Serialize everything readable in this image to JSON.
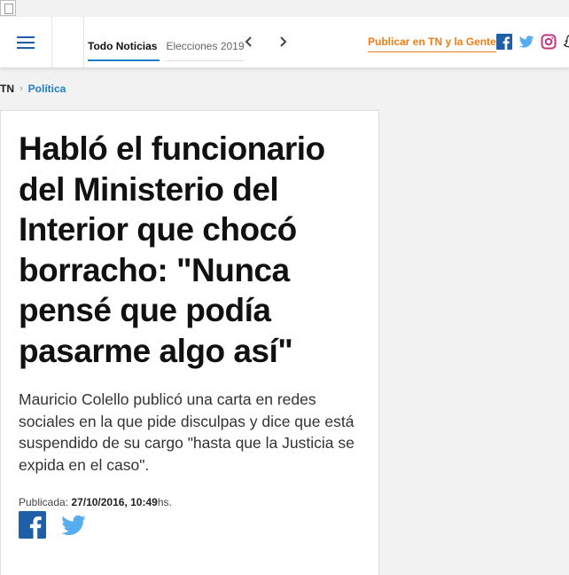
{
  "colors": {
    "brand_blue": "#1e5fa8",
    "tab_accent": "#1f7ec7",
    "publicar_orange": "#f07d16",
    "facebook": "#3b5998",
    "twitter": "#55acee",
    "instagram": "#c13584"
  },
  "header": {
    "menu_icon": "hamburger-icon",
    "tabs": [
      {
        "label": "Todo Noticias",
        "active": true
      },
      {
        "label": "Elecciones 2019",
        "active": false
      }
    ],
    "prev_icon": "chevron-left-icon",
    "next_icon": "chevron-right-icon",
    "publicar_label": "Publicar en TN y la Gente",
    "social_icons": [
      "facebook-icon",
      "twitter-icon",
      "instagram-icon",
      "snapchat-icon"
    ]
  },
  "breadcrumb": {
    "home": "TN",
    "separator_icon": "chevron-right-icon",
    "current": "Política"
  },
  "article": {
    "headline": "Habló el funcionario del Ministerio del Interior que chocó borracho: \"Nunca pensé que podía pasarme algo así\"",
    "summary": "Mauricio Colello publicó una carta en redes sociales en la que pide disculpas y dice que está suspendido de su cargo \"hasta que la Justicia se expida en el caso\".",
    "published_label": "Publicada:",
    "published_datetime": "27/10/2016, 10:49",
    "published_suffix": "hs.",
    "share_icons": [
      "facebook-icon",
      "twitter-icon"
    ]
  }
}
